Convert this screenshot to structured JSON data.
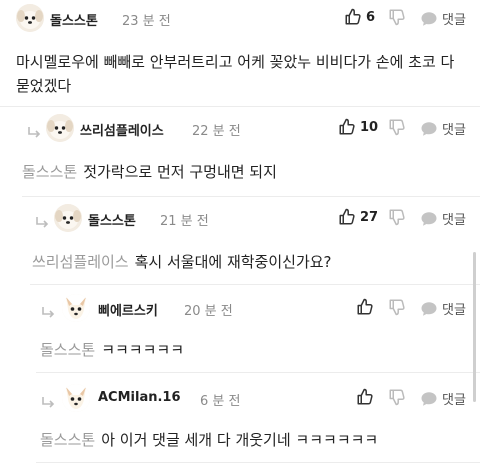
{
  "comments": [
    {
      "nickname": "돌스스톤",
      "time": "23 분 전",
      "likes": "6",
      "reply_label": "댓글",
      "body": "마시멜로우에 빼빼로 안부러트리고 어케 꽂았누 비비다가 손에 초코 다 묻었겠다"
    },
    {
      "nickname": "쓰리섬플레이스",
      "time": "22 분 전",
      "likes": "10",
      "reply_label": "댓글",
      "mention": "돌스스톤",
      "body": "젓가락으로 먼저 구멍내면 되지"
    },
    {
      "nickname": "돌스스톤",
      "time": "21 분 전",
      "likes": "27",
      "reply_label": "댓글",
      "mention": "쓰리섬플레이스",
      "body": "혹시 서울대에 재학중이신가요?"
    },
    {
      "nickname": "삐에르스키",
      "time": "20 분 전",
      "likes": "",
      "reply_label": "댓글",
      "mention": "돌스스톤",
      "body": "ㅋㅋㅋㅋㅋㅋ"
    },
    {
      "nickname": "ACMilan.16",
      "time": "6 분 전",
      "likes": "",
      "reply_label": "댓글",
      "mention": "돌스스톤",
      "body": "아 이거 댓글 세개 다 개웃기네 ㅋㅋㅋㅋㅋㅋ"
    }
  ],
  "icons": {
    "like": "thumbs-up-icon",
    "dislike": "thumbs-down-icon",
    "reply": "speech-bubble-icon",
    "reply_arrow": "reply-arrow-icon"
  },
  "colors": {
    "text": "#222222",
    "muted": "#8a8a8a",
    "mention": "#9a9a9a",
    "icon": "#444444",
    "icon_light": "#b5b5b5"
  }
}
